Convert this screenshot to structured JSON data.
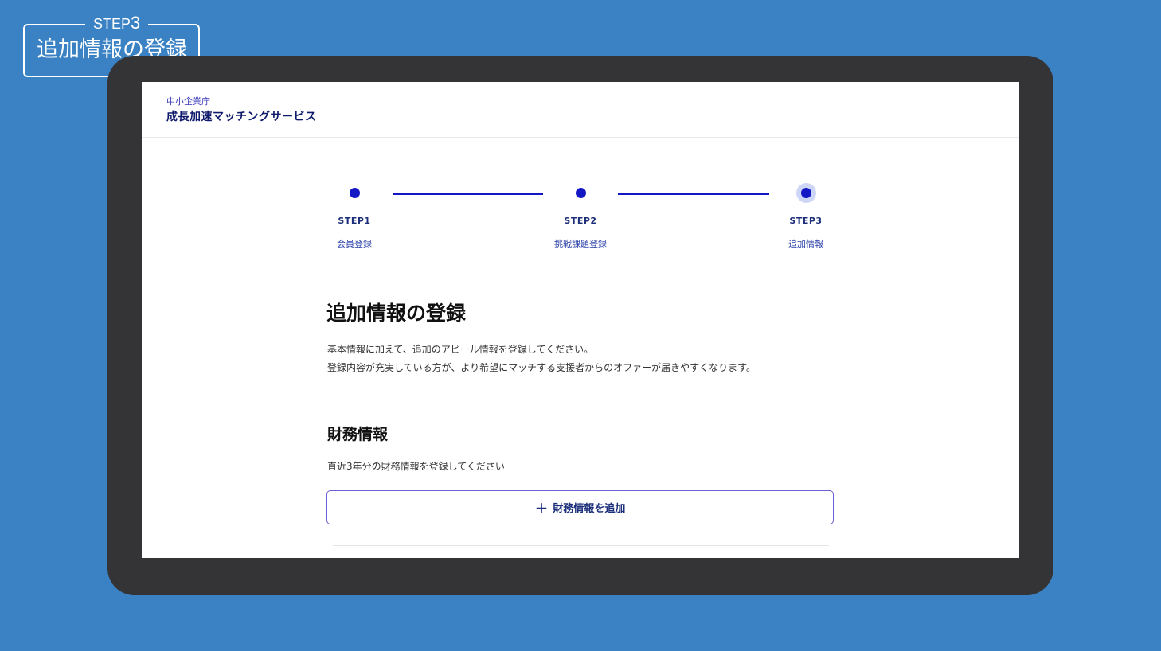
{
  "caption": {
    "step_prefix": "STEP",
    "step_number": "3",
    "title": "追加情報の登録"
  },
  "header": {
    "agency": "中小企業庁",
    "service": "成長加速マッチングサービス"
  },
  "stepper": {
    "steps": [
      {
        "num": "STEP1",
        "label": "会員登録",
        "state": "done"
      },
      {
        "num": "STEP2",
        "label": "挑戦課題登録",
        "state": "done"
      },
      {
        "num": "STEP3",
        "label": "追加情報",
        "state": "current"
      }
    ]
  },
  "main": {
    "title": "追加情報の登録",
    "description_line1": "基本情報に加えて、追加のアピール情報を登録してください。",
    "description_line2": "登録内容が充実している方が、より希望にマッチする支援者からのオファーが届きやすくなります。"
  },
  "financial": {
    "title": "財務情報",
    "description": "直近3年分の財務情報を登録してください",
    "add_button_label": "財務情報を追加",
    "add_button_icon": "plus-icon"
  },
  "colors": {
    "background": "#3b82c4",
    "device_frame": "#343437",
    "accent": "#1417c4",
    "button_border": "#6a5fd6"
  }
}
